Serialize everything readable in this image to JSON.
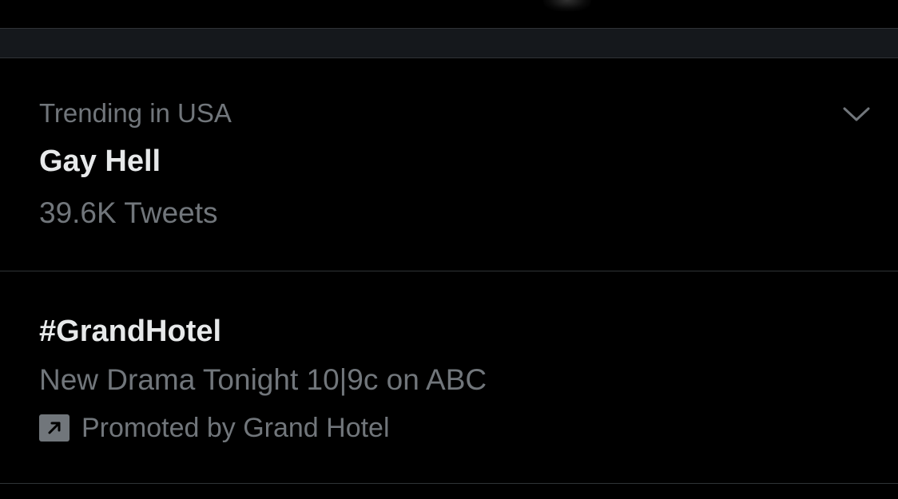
{
  "colors": {
    "background": "#000000",
    "primary_text": "#e7e9ea",
    "secondary_text": "#71767b",
    "separator": "#2f3336",
    "section_band": "#15181c"
  },
  "trends": [
    {
      "context": "Trending in USA",
      "name": "Gay Hell",
      "meta": "39.6K Tweets",
      "menu_icon": "chevron-down-icon"
    },
    {
      "name": "#GrandHotel",
      "meta": "New Drama Tonight 10|9c on ABC",
      "promoted_icon": "promoted-arrow-icon",
      "promoted_text": "Promoted by Grand Hotel"
    }
  ]
}
